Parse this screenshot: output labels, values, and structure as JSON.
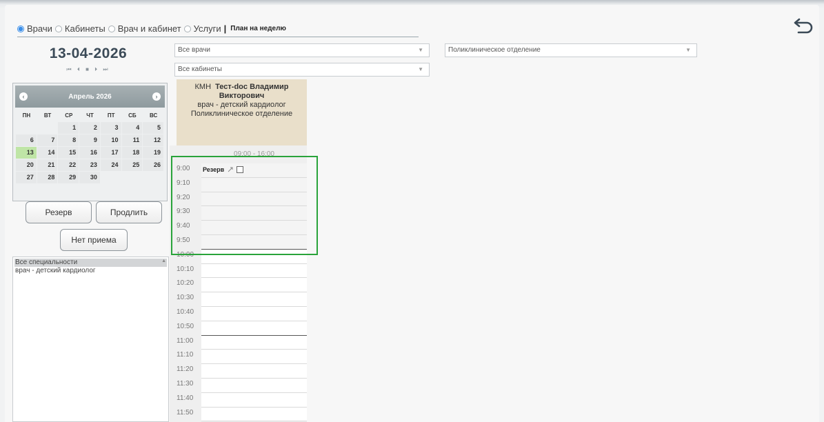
{
  "modes": [
    {
      "label": "Врачи",
      "checked": true
    },
    {
      "label": "Кабинеты",
      "checked": false
    },
    {
      "label": "Врач и кабинет",
      "checked": false
    },
    {
      "label": "Услуги",
      "checked": false
    }
  ],
  "plan_separator": "|",
  "plan_label": "План на неделю",
  "date": "13-04-2026",
  "nav_icons": [
    "first-icon",
    "prev-icon",
    "stop-icon",
    "next-icon",
    "last-icon"
  ],
  "calendar": {
    "month_label": "Апрель 2026",
    "prev_symbol": "‹",
    "next_symbol": "›",
    "weekdays": [
      "ПН",
      "ВТ",
      "СР",
      "ЧТ",
      "ПТ",
      "СБ",
      "ВС"
    ],
    "today": "13",
    "weeks": [
      [
        "",
        "",
        "1",
        "2",
        "3",
        "4",
        "5"
      ],
      [
        "6",
        "7",
        "8",
        "9",
        "10",
        "11",
        "12"
      ],
      [
        "13",
        "14",
        "15",
        "16",
        "17",
        "18",
        "19"
      ],
      [
        "20",
        "21",
        "22",
        "23",
        "24",
        "25",
        "26"
      ],
      [
        "27",
        "28",
        "29",
        "30",
        "",
        "",
        ""
      ]
    ]
  },
  "buttons": {
    "reserve": "Резерв",
    "extend": "Продлить",
    "no_reception": "Нет приема"
  },
  "specialties": [
    "Все специальности",
    "врач - детский кардиолог"
  ],
  "selects": {
    "doctors": "Все врачи",
    "rooms": "Все кабинеты",
    "department": "Поликлиническое отделение"
  },
  "doctor": {
    "room": "КМН",
    "name": "Тест-doc Владимир Викторович",
    "specialty": "врач - детский кардиолог",
    "department": "Поликлиническое отделение",
    "hours": "09:00 - 16:00"
  },
  "reserve_tag": "Резерв",
  "colors": {
    "highlight": "#29a33a",
    "today": "#bfe5a6",
    "card": "#e9dfca",
    "radio_accent": "#3b8ee8"
  },
  "slots": [
    "9:00",
    "9:10",
    "9:20",
    "9:30",
    "9:40",
    "9:50",
    "10:00",
    "10:10",
    "10:20",
    "10:30",
    "10:40",
    "10:50",
    "11:00",
    "11:10",
    "11:20",
    "11:30",
    "11:40",
    "11:50"
  ]
}
